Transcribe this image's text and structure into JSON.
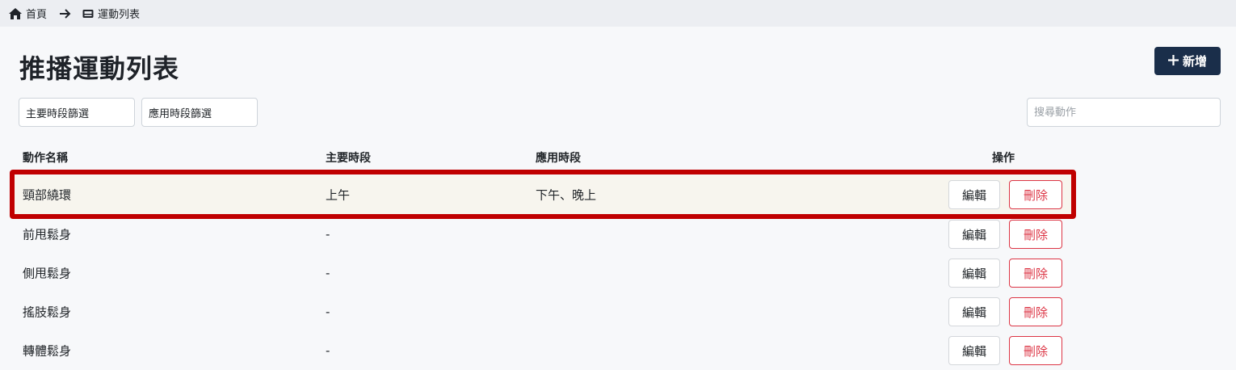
{
  "breadcrumb": {
    "home_label": "首頁",
    "current_label": "運動列表"
  },
  "page": {
    "title": "推播運動列表",
    "add_label": "新增"
  },
  "filters": {
    "primary_period": "主要時段篩選",
    "applied_period": "應用時段篩選",
    "search_placeholder": "搜尋動作"
  },
  "table": {
    "headers": [
      "動作名稱",
      "主要時段",
      "應用時段",
      "操作"
    ],
    "edit_label": "編輯",
    "delete_label": "刪除",
    "rows": [
      {
        "name": "頸部繞環",
        "primary": "上午",
        "applied": "下午、晚上",
        "highlighted": true
      },
      {
        "name": "前甩鬆身",
        "primary": "-",
        "applied": ""
      },
      {
        "name": "側甩鬆身",
        "primary": "-",
        "applied": ""
      },
      {
        "name": "搖肢鬆身",
        "primary": "-",
        "applied": ""
      },
      {
        "name": "轉體鬆身",
        "primary": "-",
        "applied": ""
      }
    ]
  },
  "colors": {
    "accent": "#1a2e4a",
    "danger": "#dc3545",
    "highlight_border": "#c00000",
    "highlight_row": "#f7f5ee"
  }
}
